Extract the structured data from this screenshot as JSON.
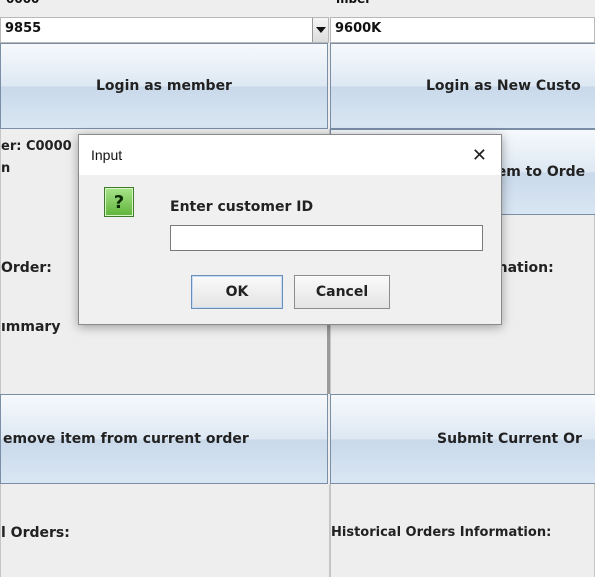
{
  "top": {
    "left_partial": "0000",
    "left_value": "9855",
    "right_partial": "mber",
    "right_value": "9600K"
  },
  "buttons": {
    "login_member": "Login as member",
    "login_new": "Login as New Custo",
    "add_item": "tem to Orde",
    "remove_item": "emove item from current order",
    "submit_order": "Submit Current Or"
  },
  "labels": {
    "customer_line1": "er: C0000",
    "customer_line2": "n",
    "order": "Order:",
    "information": "mation:",
    "summary": "ımmary",
    "orders": "l Orders:",
    "historical": "Historical Orders Information:"
  },
  "dialog": {
    "title": "Input",
    "close_glyph": "✕",
    "icon_glyph": "?",
    "prompt": "Enter customer ID",
    "input_value": "",
    "ok": "OK",
    "cancel": "Cancel"
  }
}
